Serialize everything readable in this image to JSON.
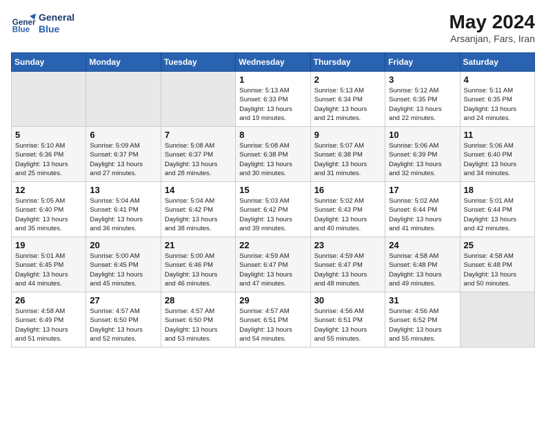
{
  "header": {
    "logo_line1": "General",
    "logo_line2": "Blue",
    "month_year": "May 2024",
    "location": "Arsanjan, Fars, Iran"
  },
  "days_of_week": [
    "Sunday",
    "Monday",
    "Tuesday",
    "Wednesday",
    "Thursday",
    "Friday",
    "Saturday"
  ],
  "weeks": [
    [
      {
        "day": "",
        "info": ""
      },
      {
        "day": "",
        "info": ""
      },
      {
        "day": "",
        "info": ""
      },
      {
        "day": "1",
        "info": "Sunrise: 5:13 AM\nSunset: 6:33 PM\nDaylight: 13 hours\nand 19 minutes."
      },
      {
        "day": "2",
        "info": "Sunrise: 5:13 AM\nSunset: 6:34 PM\nDaylight: 13 hours\nand 21 minutes."
      },
      {
        "day": "3",
        "info": "Sunrise: 5:12 AM\nSunset: 6:35 PM\nDaylight: 13 hours\nand 22 minutes."
      },
      {
        "day": "4",
        "info": "Sunrise: 5:11 AM\nSunset: 6:35 PM\nDaylight: 13 hours\nand 24 minutes."
      }
    ],
    [
      {
        "day": "5",
        "info": "Sunrise: 5:10 AM\nSunset: 6:36 PM\nDaylight: 13 hours\nand 25 minutes."
      },
      {
        "day": "6",
        "info": "Sunrise: 5:09 AM\nSunset: 6:37 PM\nDaylight: 13 hours\nand 27 minutes."
      },
      {
        "day": "7",
        "info": "Sunrise: 5:08 AM\nSunset: 6:37 PM\nDaylight: 13 hours\nand 28 minutes."
      },
      {
        "day": "8",
        "info": "Sunrise: 5:08 AM\nSunset: 6:38 PM\nDaylight: 13 hours\nand 30 minutes."
      },
      {
        "day": "9",
        "info": "Sunrise: 5:07 AM\nSunset: 6:38 PM\nDaylight: 13 hours\nand 31 minutes."
      },
      {
        "day": "10",
        "info": "Sunrise: 5:06 AM\nSunset: 6:39 PM\nDaylight: 13 hours\nand 32 minutes."
      },
      {
        "day": "11",
        "info": "Sunrise: 5:06 AM\nSunset: 6:40 PM\nDaylight: 13 hours\nand 34 minutes."
      }
    ],
    [
      {
        "day": "12",
        "info": "Sunrise: 5:05 AM\nSunset: 6:40 PM\nDaylight: 13 hours\nand 35 minutes."
      },
      {
        "day": "13",
        "info": "Sunrise: 5:04 AM\nSunset: 6:41 PM\nDaylight: 13 hours\nand 36 minutes."
      },
      {
        "day": "14",
        "info": "Sunrise: 5:04 AM\nSunset: 6:42 PM\nDaylight: 13 hours\nand 38 minutes."
      },
      {
        "day": "15",
        "info": "Sunrise: 5:03 AM\nSunset: 6:42 PM\nDaylight: 13 hours\nand 39 minutes."
      },
      {
        "day": "16",
        "info": "Sunrise: 5:02 AM\nSunset: 6:43 PM\nDaylight: 13 hours\nand 40 minutes."
      },
      {
        "day": "17",
        "info": "Sunrise: 5:02 AM\nSunset: 6:44 PM\nDaylight: 13 hours\nand 41 minutes."
      },
      {
        "day": "18",
        "info": "Sunrise: 5:01 AM\nSunset: 6:44 PM\nDaylight: 13 hours\nand 42 minutes."
      }
    ],
    [
      {
        "day": "19",
        "info": "Sunrise: 5:01 AM\nSunset: 6:45 PM\nDaylight: 13 hours\nand 44 minutes."
      },
      {
        "day": "20",
        "info": "Sunrise: 5:00 AM\nSunset: 6:45 PM\nDaylight: 13 hours\nand 45 minutes."
      },
      {
        "day": "21",
        "info": "Sunrise: 5:00 AM\nSunset: 6:46 PM\nDaylight: 13 hours\nand 46 minutes."
      },
      {
        "day": "22",
        "info": "Sunrise: 4:59 AM\nSunset: 6:47 PM\nDaylight: 13 hours\nand 47 minutes."
      },
      {
        "day": "23",
        "info": "Sunrise: 4:59 AM\nSunset: 6:47 PM\nDaylight: 13 hours\nand 48 minutes."
      },
      {
        "day": "24",
        "info": "Sunrise: 4:58 AM\nSunset: 6:48 PM\nDaylight: 13 hours\nand 49 minutes."
      },
      {
        "day": "25",
        "info": "Sunrise: 4:58 AM\nSunset: 6:48 PM\nDaylight: 13 hours\nand 50 minutes."
      }
    ],
    [
      {
        "day": "26",
        "info": "Sunrise: 4:58 AM\nSunset: 6:49 PM\nDaylight: 13 hours\nand 51 minutes."
      },
      {
        "day": "27",
        "info": "Sunrise: 4:57 AM\nSunset: 6:50 PM\nDaylight: 13 hours\nand 52 minutes."
      },
      {
        "day": "28",
        "info": "Sunrise: 4:57 AM\nSunset: 6:50 PM\nDaylight: 13 hours\nand 53 minutes."
      },
      {
        "day": "29",
        "info": "Sunrise: 4:57 AM\nSunset: 6:51 PM\nDaylight: 13 hours\nand 54 minutes."
      },
      {
        "day": "30",
        "info": "Sunrise: 4:56 AM\nSunset: 6:51 PM\nDaylight: 13 hours\nand 55 minutes."
      },
      {
        "day": "31",
        "info": "Sunrise: 4:56 AM\nSunset: 6:52 PM\nDaylight: 13 hours\nand 55 minutes."
      },
      {
        "day": "",
        "info": ""
      }
    ]
  ]
}
